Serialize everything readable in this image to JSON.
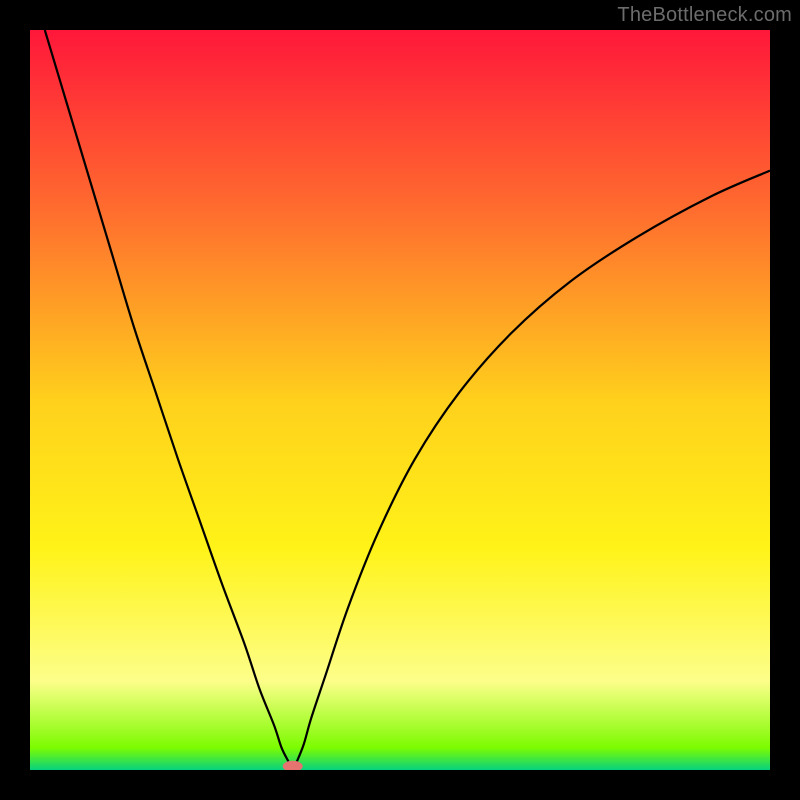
{
  "watermark": "TheBottleneck.com",
  "chart_data": {
    "type": "line",
    "title": "",
    "xlabel": "",
    "ylabel": "",
    "xlim": [
      0,
      100
    ],
    "ylim": [
      0,
      100
    ],
    "background_gradient": {
      "stops": [
        {
          "offset": 0.0,
          "color": "#ff173a"
        },
        {
          "offset": 0.25,
          "color": "#ff6f2e"
        },
        {
          "offset": 0.5,
          "color": "#ffd01c"
        },
        {
          "offset": 0.7,
          "color": "#fff318"
        },
        {
          "offset": 0.88,
          "color": "#fdfe8a"
        },
        {
          "offset": 0.97,
          "color": "#7CFC00"
        },
        {
          "offset": 1.0,
          "color": "#06d27e"
        }
      ]
    },
    "series": [
      {
        "name": "bottleneck-curve",
        "color": "#000000",
        "x": [
          2,
          5,
          8,
          11,
          14,
          17,
          20,
          23,
          26,
          29,
          31,
          33,
          34,
          35,
          35.5,
          36,
          37,
          38,
          40,
          43,
          47,
          52,
          58,
          65,
          73,
          82,
          92,
          100
        ],
        "y": [
          100,
          90,
          80,
          70,
          60,
          51,
          42,
          33.5,
          25,
          17,
          11,
          6,
          3,
          1,
          0,
          1,
          3.5,
          7,
          13,
          22,
          32,
          42,
          51,
          59,
          66,
          72,
          77.5,
          81
        ]
      }
    ],
    "marker": {
      "name": "optimum-marker",
      "x": 35.5,
      "y": 0.5,
      "color": "#e5736f",
      "rx": 10,
      "ry": 5.5
    }
  }
}
